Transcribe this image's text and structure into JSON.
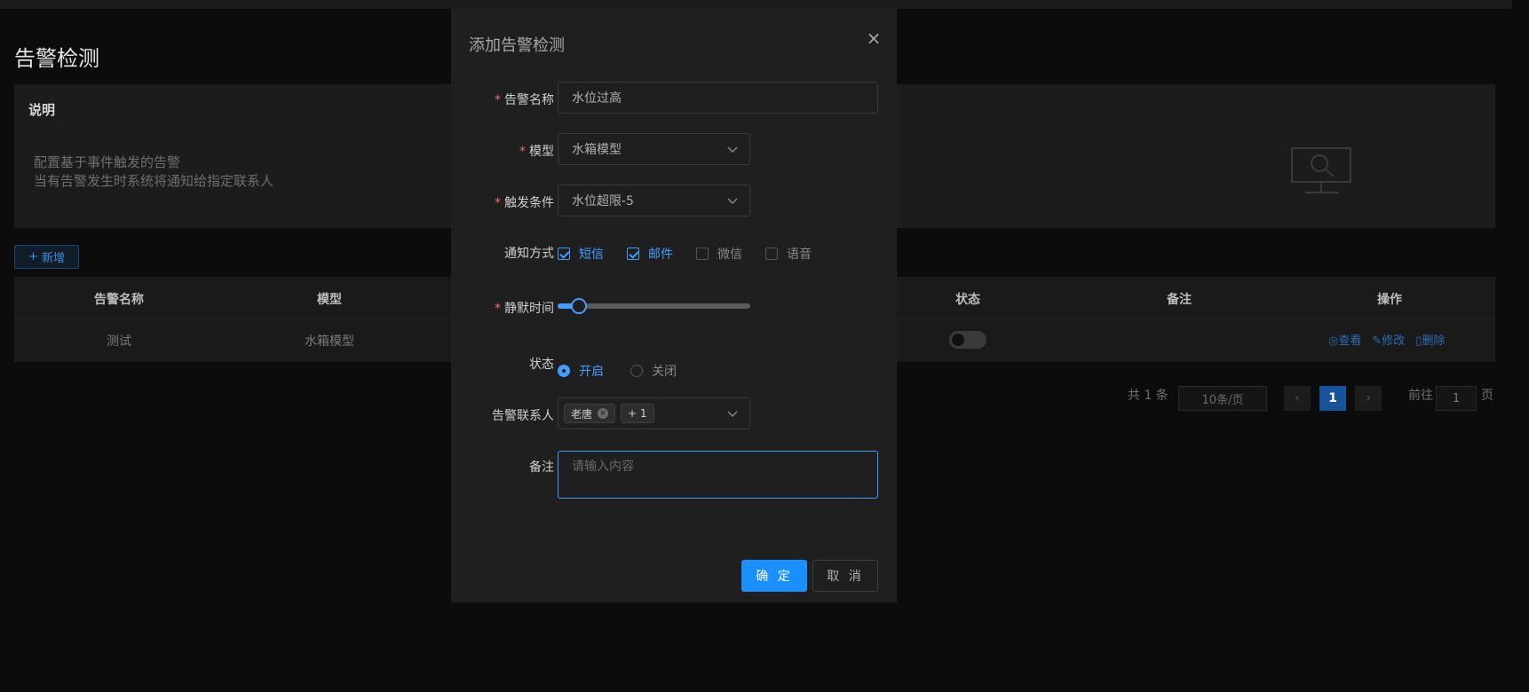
{
  "page": {
    "title": "告警检测",
    "description": {
      "heading": "说明",
      "lines": [
        "配置基于事件触发的告警",
        "当有告警发生时系统将通知给指定联系人"
      ]
    },
    "add_button": "新增",
    "table": {
      "columns": [
        "告警名称",
        "模型",
        "状态",
        "备注",
        "操作"
      ],
      "rows": [
        {
          "name": "测试",
          "model": "水箱模型",
          "enabled": false,
          "remark": ""
        }
      ],
      "actions": [
        "查看",
        "修改",
        "删除"
      ]
    },
    "pagination": {
      "total_text": "共 1 条",
      "page_size": "10条/页",
      "current_page": "1",
      "goto_label": "前往",
      "goto_value": "1",
      "goto_suffix": "页"
    }
  },
  "modal": {
    "title": "添加告警检测",
    "fields": {
      "alarm_name": {
        "label": "告警名称",
        "value": "水位过高",
        "required": true
      },
      "model": {
        "label": "模型",
        "value": "水箱模型",
        "required": true
      },
      "trigger": {
        "label": "触发条件",
        "value": "水位超限-5",
        "required": true
      },
      "notify": {
        "label": "通知方式",
        "options": [
          {
            "label": "短信",
            "checked": true
          },
          {
            "label": "邮件",
            "checked": true
          },
          {
            "label": "微信",
            "checked": false
          },
          {
            "label": "语音",
            "checked": false
          }
        ]
      },
      "silence": {
        "label": "静默时间",
        "required": true,
        "value_fraction": 0.11
      },
      "status": {
        "label": "状态",
        "options": [
          {
            "label": "开启",
            "selected": true
          },
          {
            "label": "关闭",
            "selected": false
          }
        ]
      },
      "contacts": {
        "label": "告警联系人",
        "tags": [
          "老唐"
        ],
        "more": "+ 1"
      },
      "remark": {
        "label": "备注",
        "placeholder": "请输入内容"
      }
    },
    "buttons": {
      "confirm": "确 定",
      "cancel": "取 消"
    }
  },
  "colors": {
    "accent": "#1890ff",
    "required": "#f56c6c",
    "modal_bg": "#1f1f1f",
    "page_bg": "#0c0c0c"
  }
}
